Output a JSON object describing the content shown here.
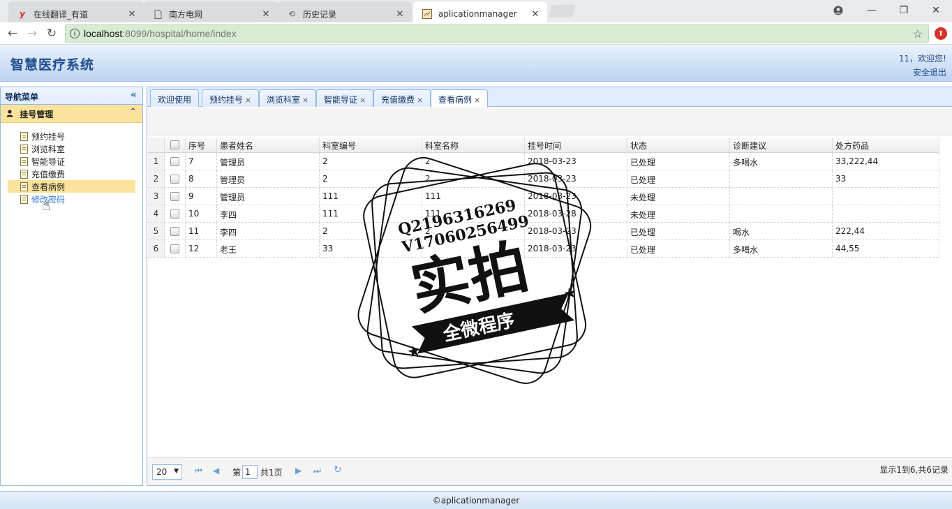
{
  "browser": {
    "tabs": [
      {
        "label": "在线翻译_有道",
        "icon": "youdao-icon"
      },
      {
        "label": "南方电网",
        "icon": "page-icon"
      },
      {
        "label": "历史记录",
        "icon": "history-icon"
      },
      {
        "label": "aplicationmanager",
        "icon": "app-icon"
      }
    ],
    "url_host": "localhost",
    "url_path": ":8099/hospital/home/index"
  },
  "app": {
    "title": "智慧医疗系统",
    "welcome": "11，欢迎您!",
    "logout": "安全退出"
  },
  "sidebar": {
    "title": "导航菜单",
    "section": "挂号管理",
    "items": [
      {
        "label": "预约挂号"
      },
      {
        "label": "浏览科室"
      },
      {
        "label": "智能导证"
      },
      {
        "label": "充值缴费"
      },
      {
        "label": "查看病例"
      },
      {
        "label": "修改密码"
      }
    ]
  },
  "tabs": [
    {
      "label": "欢迎使用"
    },
    {
      "label": "预约挂号"
    },
    {
      "label": "浏览科室"
    },
    {
      "label": "智能导证"
    },
    {
      "label": "充值缴费"
    },
    {
      "label": "查看病例"
    }
  ],
  "table": {
    "columns": [
      "序号",
      "患者姓名",
      "科室编号",
      "科室名称",
      "挂号时间",
      "状态",
      "诊断建议",
      "处方药品"
    ],
    "rows": [
      [
        "1",
        "7",
        "管理员",
        "2",
        "2",
        "2018-03-23",
        "已处理",
        "多喝水",
        "33,222,44"
      ],
      [
        "2",
        "8",
        "管理员",
        "2",
        "2",
        "2018-03-23",
        "已处理",
        "",
        "33"
      ],
      [
        "3",
        "9",
        "管理员",
        "111",
        "111",
        "2018-03-23",
        "未处理",
        "",
        ""
      ],
      [
        "4",
        "10",
        "李四",
        "111",
        "111",
        "2018-03-28",
        "未处理",
        "",
        ""
      ],
      [
        "5",
        "11",
        "李四",
        "2",
        "2",
        "2018-03-23",
        "已处理",
        "喝水",
        "222,44"
      ],
      [
        "6",
        "12",
        "老王",
        "33",
        "",
        "2018-03-23",
        "已处理",
        "多喝水",
        "44,55"
      ]
    ]
  },
  "pager": {
    "page_size": "20",
    "page_prefix": "第",
    "page_value": "1",
    "page_suffix": "共1页",
    "info": "显示1到6,共6记录"
  },
  "footer": "©aplicationmanager",
  "watermark": {
    "line1": "Q2196316269",
    "line2": "V17060256499",
    "main": "实拍",
    "banner": "全微程序"
  }
}
